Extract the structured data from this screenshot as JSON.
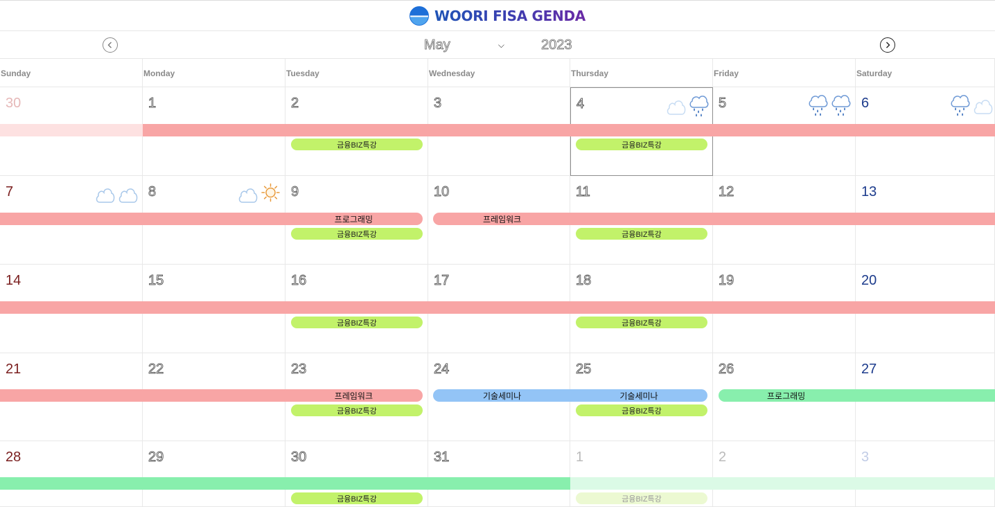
{
  "header": {
    "title": "WOORI FISA GENDA"
  },
  "nav": {
    "month": "May",
    "year": "2023",
    "prev_icon": "chevron-left-icon",
    "next_icon": "chevron-right-icon",
    "caret_icon": "chevron-down-icon"
  },
  "weekdays": [
    "Sunday",
    "Monday",
    "Tuesday",
    "Wednesday",
    "Thursday",
    "Friday",
    "Saturday"
  ],
  "colors": {
    "red_bar": "#f8a5a5",
    "red_bar_faded": "#fde1e1",
    "green_pill": "#c2f26a",
    "green_pill_faded": "#ecf9d2",
    "blue_bar": "#93c4f6",
    "mint_bar": "#88efad",
    "mint_bar_faded": "#dbfae6",
    "sunday_text": "#7a1e1e",
    "saturday_text": "#1c3b8c"
  },
  "today": "May 4",
  "weeks": [
    [
      "30",
      "1",
      "2",
      "3",
      "4",
      "5",
      "6"
    ],
    [
      "7",
      "8",
      "9",
      "10",
      "11",
      "12",
      "13"
    ],
    [
      "14",
      "15",
      "16",
      "17",
      "18",
      "19",
      "20"
    ],
    [
      "21",
      "22",
      "23",
      "24",
      "25",
      "26",
      "27"
    ],
    [
      "28",
      "29",
      "30",
      "31",
      "1",
      "2",
      "3"
    ]
  ],
  "weather": {
    "may_4": [
      "cloud-icon",
      "rain-icon"
    ],
    "may_5": [
      "rain-icon",
      "rain-icon"
    ],
    "may_6": [
      "rain-icon",
      "cloud-icon"
    ],
    "may_7": [
      "cloud-icon",
      "cloud-icon"
    ],
    "may_8": [
      "cloud-icon",
      "sun-icon"
    ]
  },
  "events": {
    "biz": "금융BIZ특강",
    "programming": "프로그래밍",
    "framework": "프레임워크",
    "seminar": "기술세미나"
  }
}
